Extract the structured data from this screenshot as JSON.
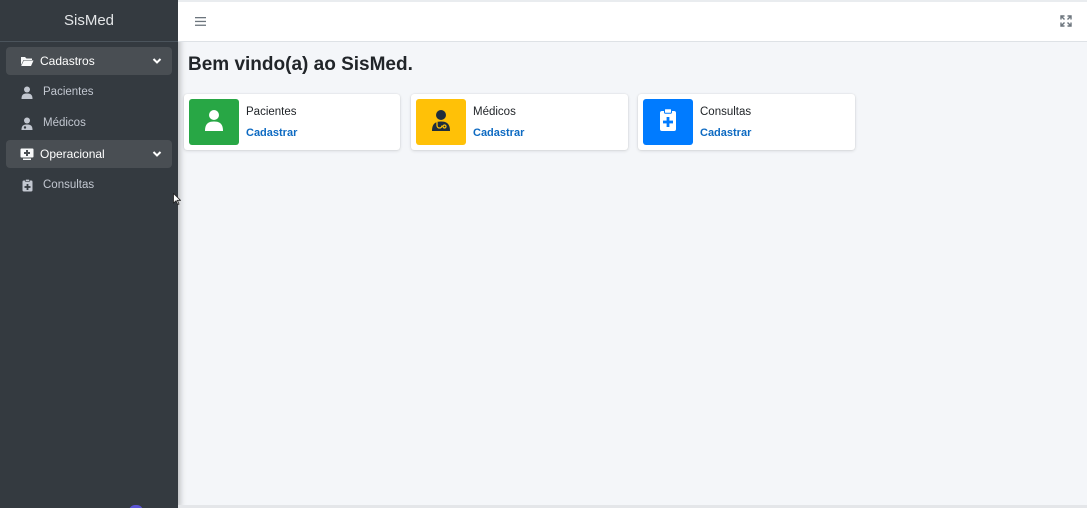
{
  "app": {
    "brand": "SisMed"
  },
  "sidebar": {
    "sections": [
      {
        "label": "Cadastros",
        "icon": "folder-open-icon",
        "items": [
          {
            "label": "Pacientes",
            "icon": "user-icon"
          },
          {
            "label": "Médicos",
            "icon": "user-md-icon"
          }
        ]
      },
      {
        "label": "Operacional",
        "icon": "clinic-monitor-icon",
        "items": [
          {
            "label": "Consultas",
            "icon": "clipboard-plus-icon"
          }
        ]
      }
    ]
  },
  "main": {
    "welcome": "Bem vindo(a) ao SisMed.",
    "cards": [
      {
        "title": "Pacientes",
        "action": "Cadastrar",
        "color": "#28a745",
        "icon": "user-icon"
      },
      {
        "title": "Médicos",
        "action": "Cadastrar",
        "color": "#ffc107",
        "icon": "doctor-icon"
      },
      {
        "title": "Consultas",
        "action": "Cadastrar",
        "color": "#007bff",
        "icon": "clipboard-plus-icon"
      }
    ]
  },
  "colors": {
    "sidebar_bg": "#343a40",
    "link": "#0d6ac2",
    "page_bg": "#f4f6f9"
  }
}
